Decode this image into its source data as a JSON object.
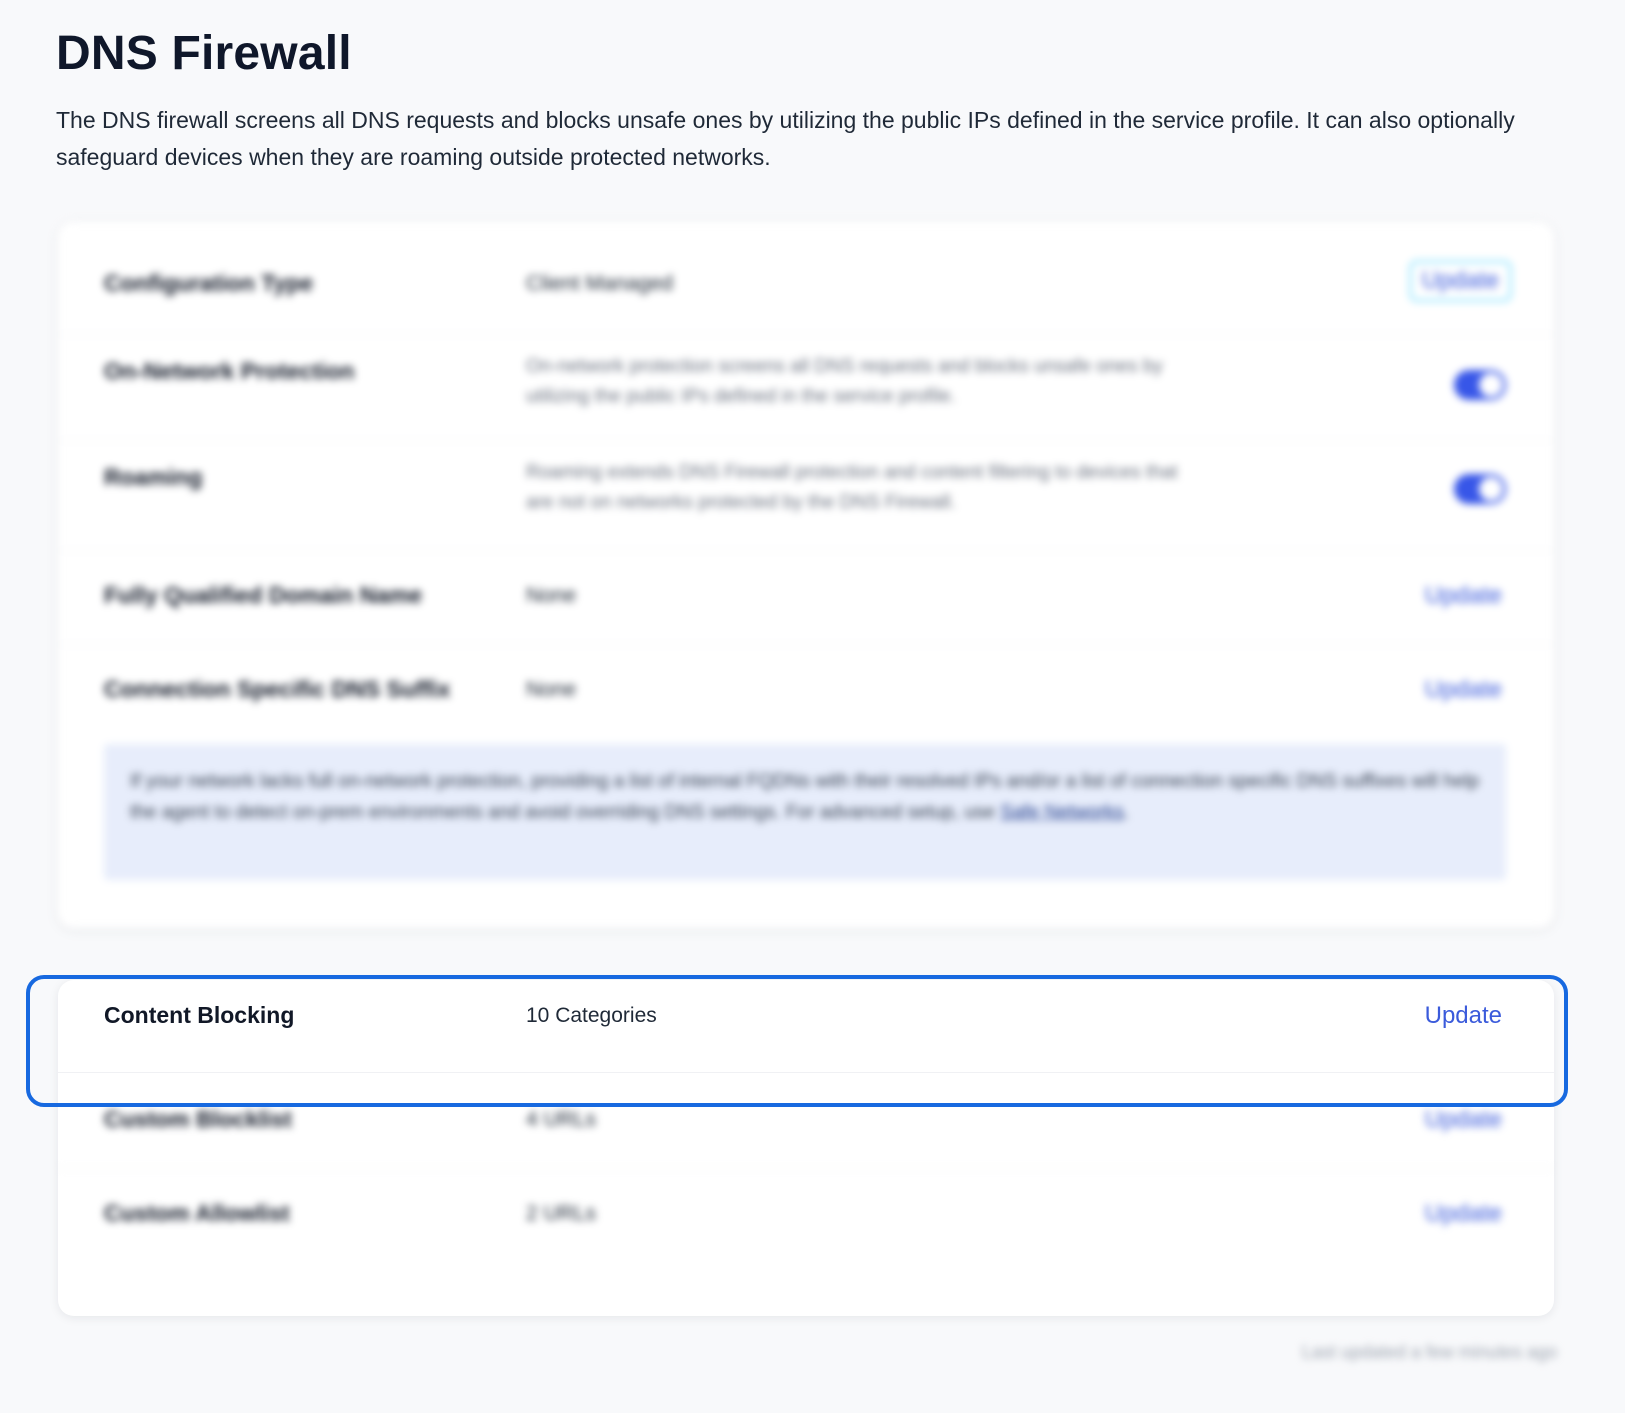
{
  "page": {
    "title": "DNS Firewall",
    "description": "The DNS firewall screens all DNS requests and blocks unsafe ones by utilizing the public IPs defined in the service profile. It can also optionally safeguard devices when they are roaming outside protected networks."
  },
  "settings": {
    "configuration_type": {
      "label": "Configuration Type",
      "value": "Client Managed",
      "action": "Update"
    },
    "on_network_protection": {
      "label": "On-Network Protection",
      "description": "On-network protection screens all DNS requests and blocks unsafe ones by utilizing the public IPs defined in the service profile.",
      "enabled": true
    },
    "roaming": {
      "label": "Roaming",
      "description": "Roaming extends DNS Firewall protection and content filtering to devices that are not on networks protected by the DNS Firewall.",
      "enabled": true
    },
    "fqdn": {
      "label": "Fully Qualified Domain Name",
      "value": "None",
      "action": "Update"
    },
    "dns_suffix": {
      "label": "Connection Specific DNS Suffix",
      "value": "None",
      "action": "Update"
    },
    "info": {
      "text": "If your network lacks full on-network protection, providing a list of internal FQDNs with their resolved IPs and/or a list of connection specific DNS suffixes will help the agent to detect on-prem environments and avoid overriding DNS settings. For advanced setup, use ",
      "link": "Safe Networks",
      "suffix": "."
    }
  },
  "filtering": {
    "content_blocking": {
      "label": "Content Blocking",
      "value": "10 Categories",
      "action": "Update"
    },
    "custom_blocklist": {
      "label": "Custom Blocklist",
      "value": "4 URLs",
      "action": "Update"
    },
    "custom_allowlist": {
      "label": "Custom Allowlist",
      "value": "2 URLs",
      "action": "Update"
    }
  },
  "footer": {
    "last_updated": "Last updated a few minutes ago"
  },
  "colors": {
    "accent": "#3b5bdb",
    "toggle_on": "#3756e8",
    "highlight": "#1769e0",
    "info_bg": "#e7edfb"
  }
}
